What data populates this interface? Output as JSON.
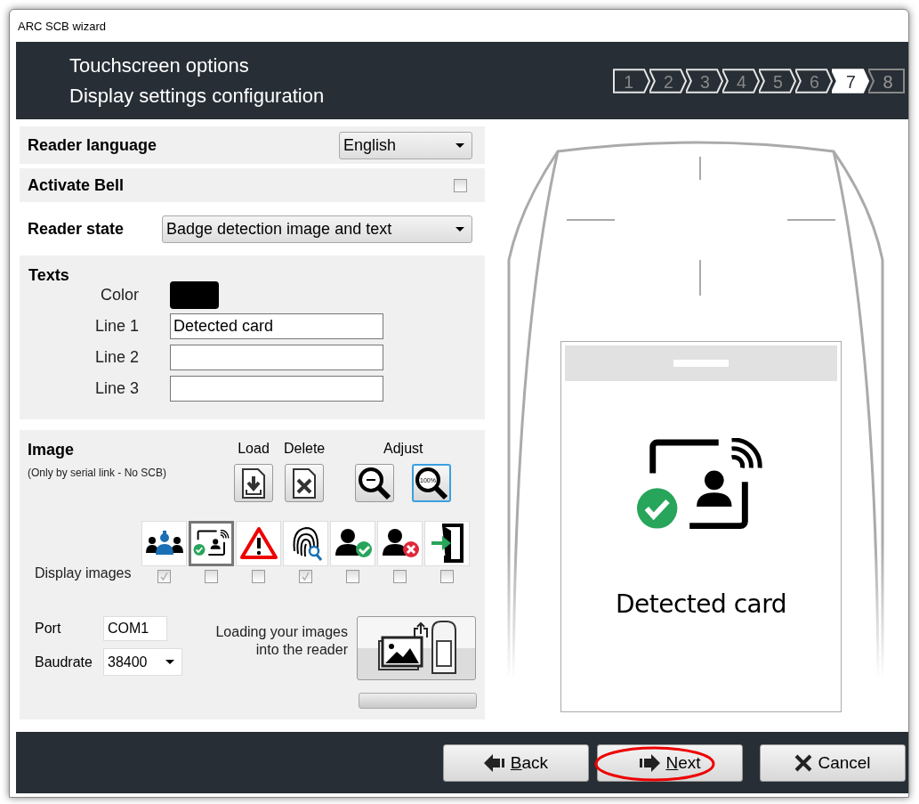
{
  "window": {
    "title": "ARC SCB wizard"
  },
  "header": {
    "title": "Touchscreen options",
    "subtitle": "Display settings configuration",
    "steps": [
      {
        "label": "1",
        "selected": false,
        "completed": true
      },
      {
        "label": "2",
        "selected": false,
        "completed": true
      },
      {
        "label": "3",
        "selected": false,
        "completed": true
      },
      {
        "label": "4",
        "selected": false,
        "completed": true
      },
      {
        "label": "5",
        "selected": false,
        "completed": true
      },
      {
        "label": "6",
        "selected": false,
        "completed": true
      },
      {
        "label": "7",
        "selected": true,
        "completed": false
      },
      {
        "label": "8",
        "selected": false,
        "completed": false
      }
    ]
  },
  "reader_language": {
    "label": "Reader language",
    "value": "English"
  },
  "activate_bell": {
    "label": "Activate Bell",
    "checked": false
  },
  "reader_state": {
    "label": "Reader state",
    "value": "Badge detection image and text"
  },
  "texts": {
    "title": "Texts",
    "color_label": "Color",
    "color": "#000000",
    "lines": [
      {
        "label": "Line 1",
        "value": "Detected card"
      },
      {
        "label": "Line 2"
      },
      {
        "label": "Line 3"
      }
    ]
  },
  "image": {
    "title": "Image",
    "note": "(Only by serial link - No SCB)",
    "actions": [
      {
        "heading": "Load",
        "kind": "load"
      },
      {
        "heading": "Delete",
        "kind": "delete"
      }
    ],
    "adjust": {
      "heading": "Adjust",
      "buttons": [
        {
          "kind": "zoom-out",
          "selected": false
        },
        {
          "kind": "zoom-100",
          "label": "100%",
          "selected": true
        }
      ]
    },
    "display_label": "Display images",
    "thumbnails": [
      {
        "kind": "group",
        "selected": false,
        "checked": true
      },
      {
        "kind": "card-detected",
        "selected": true,
        "checked": false
      },
      {
        "kind": "warning",
        "selected": false,
        "checked": false
      },
      {
        "kind": "fingerprint",
        "selected": false,
        "checked": true
      },
      {
        "kind": "user-ok",
        "selected": false,
        "checked": false
      },
      {
        "kind": "user-denied",
        "selected": false,
        "checked": false
      },
      {
        "kind": "exit",
        "selected": false,
        "checked": false
      }
    ],
    "port": {
      "label": "Port",
      "value": "COM1"
    },
    "baudrate": {
      "label": "Baudrate",
      "value": "38400"
    },
    "loading_text": "Loading your images into the reader",
    "upload_progress": {
      "level": 0
    }
  },
  "preview": {
    "text": "Detected card"
  },
  "buttons": [
    {
      "label": "Back",
      "kind": "back",
      "mnemonic_underlined": true,
      "highlighted": false
    },
    {
      "label": "Next",
      "kind": "next",
      "mnemonic_underlined": true,
      "highlighted": true
    },
    {
      "label": "Cancel",
      "kind": "cancel",
      "mnemonic_underlined": false,
      "highlighted": false
    }
  ]
}
